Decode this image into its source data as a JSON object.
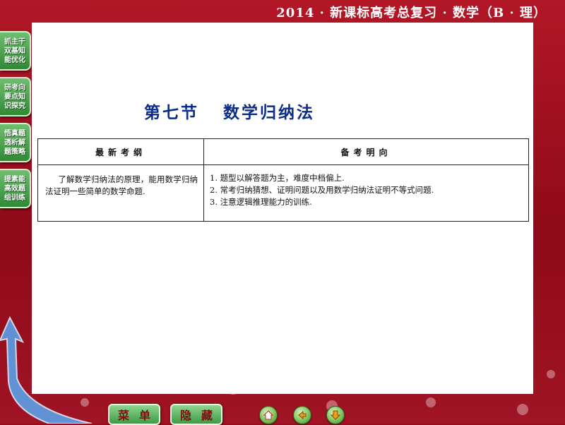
{
  "header": {
    "title": "2014 · 新课标高考总复习 · 数学（B · 理）"
  },
  "sidebar": {
    "items": [
      {
        "label": "抓主干双基知能优化"
      },
      {
        "label": "研考向要点知识探究"
      },
      {
        "label": "悟真题透析解题策略"
      },
      {
        "label": "提素能高效题组训练"
      }
    ]
  },
  "slide": {
    "section": "第七节",
    "topic": "数学归纳法",
    "table": {
      "headers": [
        "最新考纲",
        "备考明向"
      ],
      "syllabus": "了解数学归纳法的原理，能用数学归纳法证明一些简单的数学命题.",
      "guidance": [
        "1. 题型以解答题为主，难度中档偏上.",
        "2. 常考归纳猜想、证明问题以及用数学归纳法证明不等式问题.",
        "3. 注意逻辑推理能力的训练."
      ]
    }
  },
  "toolbar": {
    "menu_label": "菜单",
    "hide_label": "隐藏"
  },
  "icons": {
    "home": "home-icon",
    "back": "back-icon",
    "next": "down-arrow-icon"
  },
  "colors": {
    "background": "#9a0d1c",
    "title": "#0b2d8a",
    "nav_green": "#3d9c43",
    "toolbar_text": "#7a1010"
  }
}
